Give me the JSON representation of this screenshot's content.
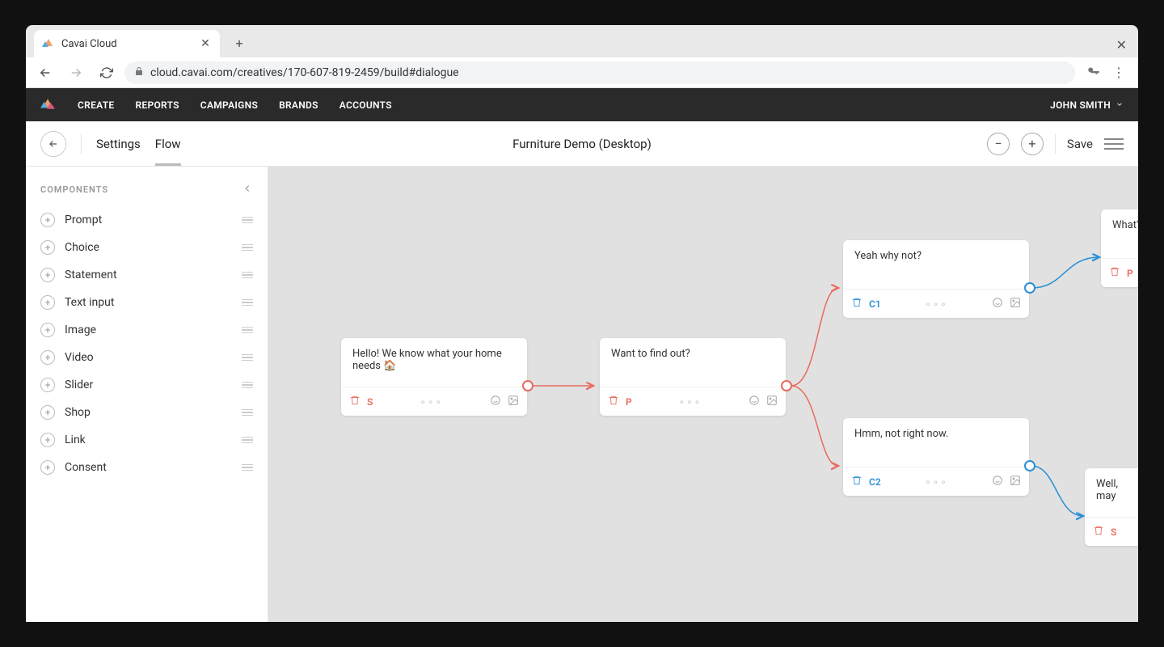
{
  "browser": {
    "tab_title": "Cavai Cloud",
    "url": "cloud.cavai.com/creatives/170-607-819-2459/build#dialogue"
  },
  "nav": {
    "items": [
      "CREATE",
      "REPORTS",
      "CAMPAIGNS",
      "BRANDS",
      "ACCOUNTS"
    ],
    "user": "JOHN SMITH"
  },
  "subbar": {
    "settings": "Settings",
    "flow": "Flow",
    "title": "Furniture Demo (Desktop)",
    "save": "Save"
  },
  "sidebar": {
    "header": "COMPONENTS",
    "items": [
      "Prompt",
      "Choice",
      "Statement",
      "Text input",
      "Image",
      "Video",
      "Slider",
      "Shop",
      "Link",
      "Consent"
    ]
  },
  "nodes": {
    "n1": {
      "text": "Hello! We know what your home needs 🏠",
      "tag": "S"
    },
    "n2": {
      "text": "Want to find out?",
      "tag": "P"
    },
    "n3": {
      "text": "Yeah why not?",
      "tag": "C1"
    },
    "n4": {
      "text": "Hmm, not right now.",
      "tag": "C2"
    },
    "n5": {
      "text": "What's",
      "tag": "P"
    },
    "n6": {
      "text": "Well, may",
      "tag": "S"
    }
  }
}
